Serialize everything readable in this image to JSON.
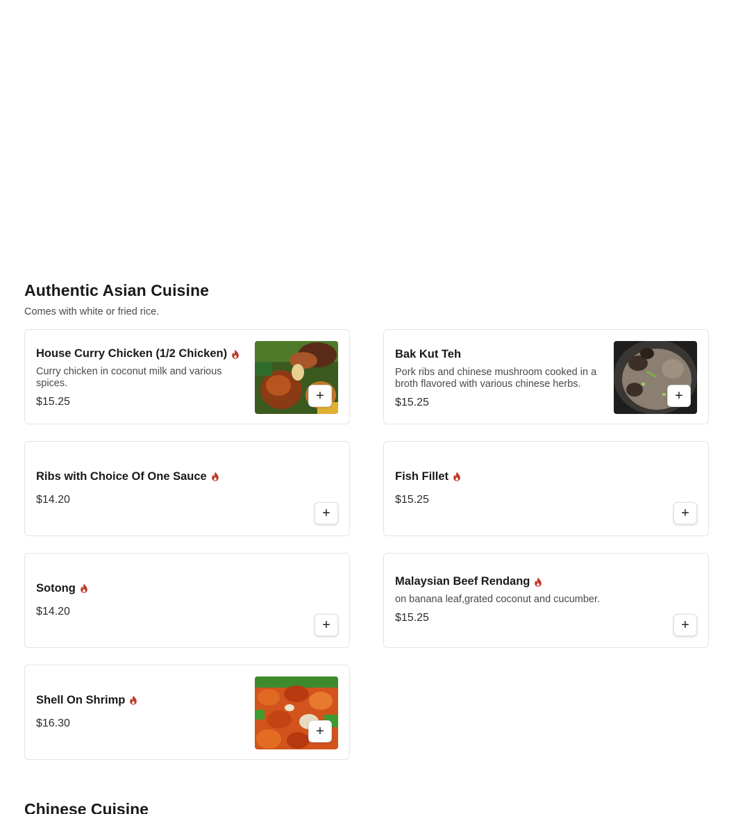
{
  "section": {
    "title": "Authentic Asian Cuisine",
    "subtitle": "Comes with white or fried rice."
  },
  "items": [
    {
      "name": "House Curry Chicken (1/2 Chicken)",
      "spicy": true,
      "description": "Curry chicken in coconut milk and various spices.",
      "price": "$15.25",
      "image": "curry-chicken-photo"
    },
    {
      "name": "Bak Kut Teh",
      "spicy": false,
      "description": "Pork ribs and chinese mushroom cooked in a broth flavored with various chinese herbs.",
      "price": "$15.25",
      "image": "bak-kut-teh-photo"
    },
    {
      "name": "Ribs with Choice Of One Sauce",
      "spicy": true,
      "description": "",
      "price": "$14.20"
    },
    {
      "name": "Fish Fillet",
      "spicy": true,
      "description": "",
      "price": "$15.25"
    },
    {
      "name": "Sotong",
      "spicy": true,
      "description": "",
      "price": "$14.20"
    },
    {
      "name": "Malaysian Beef Rendang",
      "spicy": true,
      "description": "on banana leaf,grated coconut and cucumber.",
      "price": "$15.25"
    },
    {
      "name": "Shell On Shrimp",
      "spicy": true,
      "description": "",
      "price": "$16.30",
      "image": "shrimp-photo"
    }
  ],
  "add_button_label": "+",
  "next_section": {
    "title": "Chinese Cuisine"
  },
  "colors": {
    "spicy": "#c0392b",
    "border": "#e4e4e4",
    "text": "#191919",
    "muted": "#494949"
  }
}
